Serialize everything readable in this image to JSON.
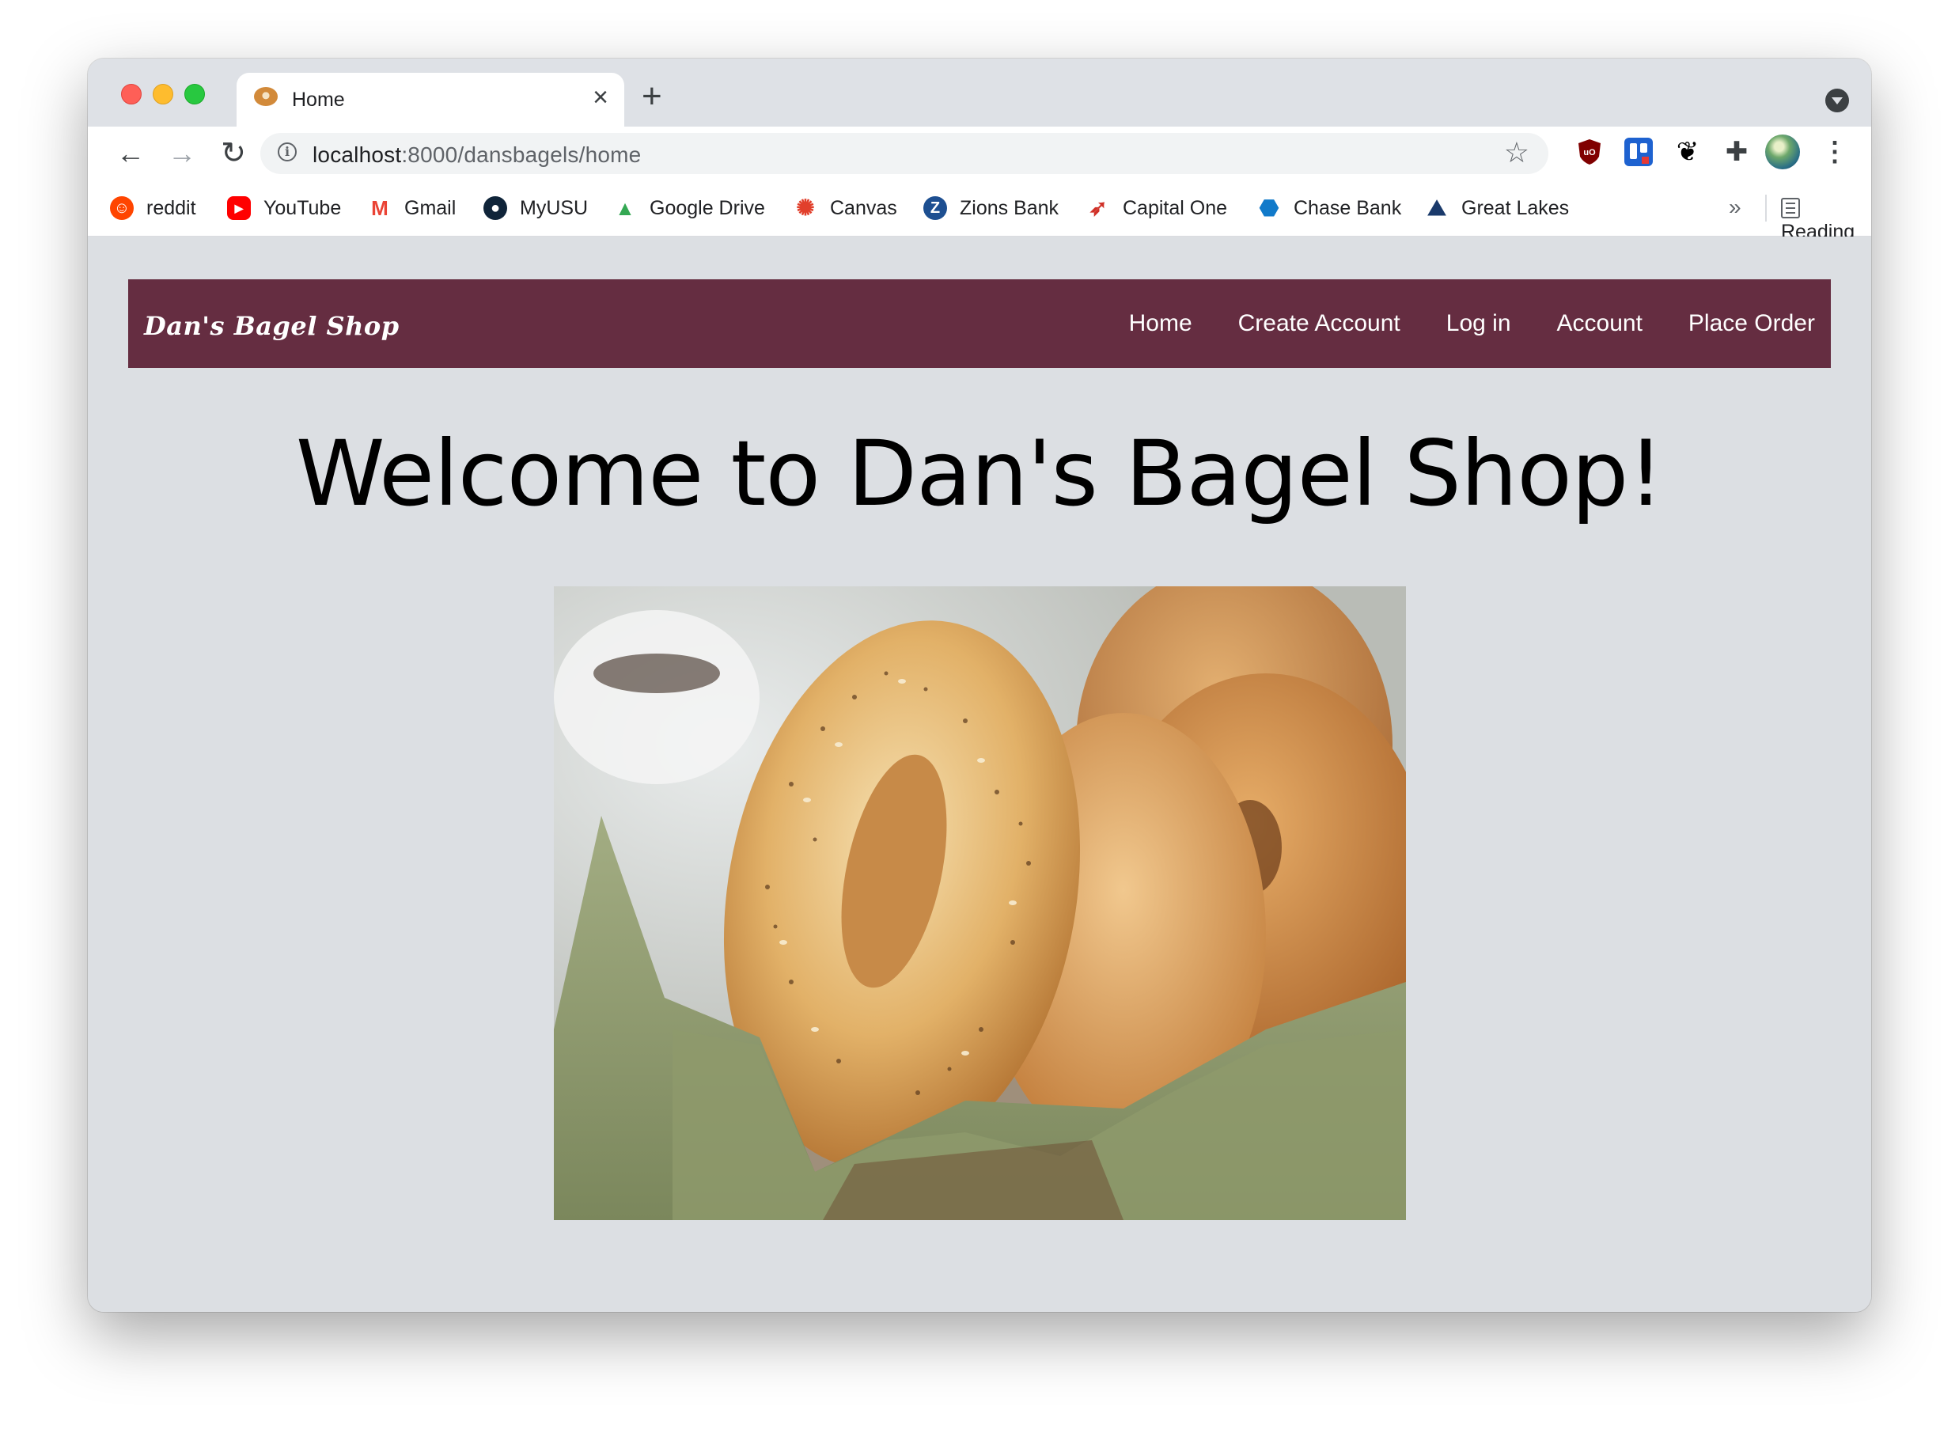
{
  "browser": {
    "tab_title": "Home",
    "url_host": "localhost",
    "url_path": ":8000/dansbagels/home",
    "icons": {
      "back": "arrow-left-icon",
      "forward": "arrow-right-icon",
      "reload": "reload-icon",
      "info": "info-icon",
      "bookmark_star": "star-icon",
      "close_tab": "close-icon",
      "new_tab": "plus-icon"
    }
  },
  "bookmarks": [
    {
      "label": "reddit",
      "icon": "reddit-icon",
      "color": "#ff4500"
    },
    {
      "label": "YouTube",
      "icon": "youtube-icon",
      "color": "#ff0000"
    },
    {
      "label": "Gmail",
      "icon": "gmail-icon",
      "color": "#ea4335"
    },
    {
      "label": "MyUSU",
      "icon": "myusu-icon",
      "color": "#0f2439"
    },
    {
      "label": "Google Drive",
      "icon": "google-drive-icon",
      "color": "#34a853"
    },
    {
      "label": "Canvas",
      "icon": "canvas-icon",
      "color": "#e13f2b"
    },
    {
      "label": "Zions Bank",
      "icon": "zions-bank-icon",
      "color": "#1d4f91"
    },
    {
      "label": "Capital One",
      "icon": "capital-one-icon",
      "color": "#d03027"
    },
    {
      "label": "Chase Bank",
      "icon": "chase-bank-icon",
      "color": "#117aca"
    },
    {
      "label": "Great Lakes",
      "icon": "great-lakes-icon",
      "color": "#1a3a6b"
    }
  ],
  "reading_list": "Reading List",
  "overflow_label": "»",
  "site": {
    "brand": "Dan's Bagel Shop",
    "brand_color": "#652d41",
    "nav": [
      "Home",
      "Create Account",
      "Log in",
      "Account",
      "Place Order"
    ],
    "headline": "Welcome to Dan's Bagel Shop!",
    "hero_image": "bagels-in-basket-photo"
  }
}
